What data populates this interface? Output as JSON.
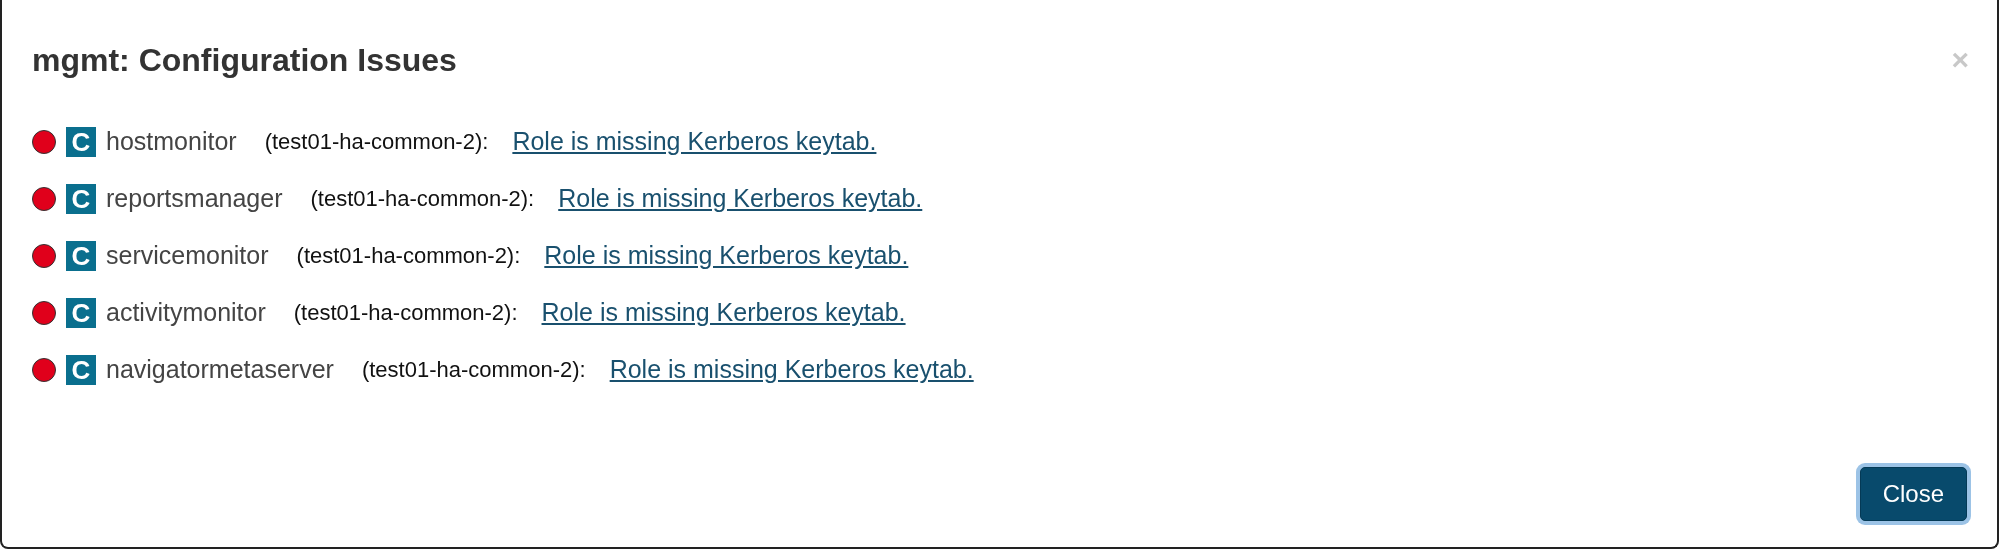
{
  "dialog": {
    "title": "mgmt: Configuration Issues",
    "close_icon": "×"
  },
  "issues": [
    {
      "color": "#e0001b",
      "badge": "C",
      "role": "hostmonitor",
      "host": "(test01-ha-common-2):",
      "message": "Role is missing Kerberos keytab."
    },
    {
      "color": "#e0001b",
      "badge": "C",
      "role": "reportsmanager",
      "host": "(test01-ha-common-2):",
      "message": "Role is missing Kerberos keytab."
    },
    {
      "color": "#e0001b",
      "badge": "C",
      "role": "servicemonitor",
      "host": "(test01-ha-common-2):",
      "message": "Role is missing Kerberos keytab."
    },
    {
      "color": "#e0001b",
      "badge": "C",
      "role": "activitymonitor",
      "host": "(test01-ha-common-2):",
      "message": "Role is missing Kerberos keytab."
    },
    {
      "color": "#e0001b",
      "badge": "C",
      "role": "navigatormetaserver",
      "host": "(test01-ha-common-2):",
      "message": "Role is missing Kerberos keytab."
    }
  ],
  "buttons": [
    {
      "label": "Close"
    }
  ]
}
